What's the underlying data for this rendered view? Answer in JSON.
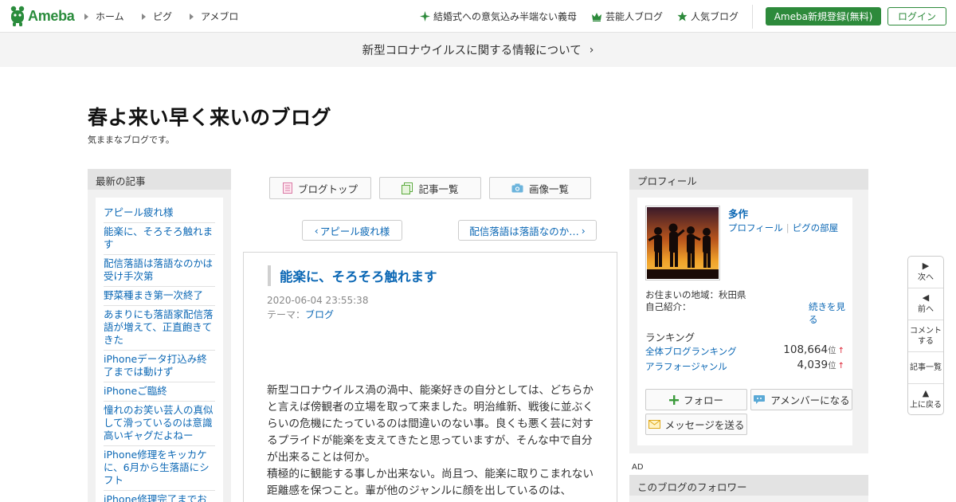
{
  "header": {
    "logo_text": "Ameba",
    "nav": [
      "ホーム",
      "ピグ",
      "アメブロ"
    ],
    "links": [
      {
        "label": "結婚式への意気込み半端ない義母",
        "icon": "sparkle-icon"
      },
      {
        "label": "芸能人ブログ",
        "icon": "crown-icon"
      },
      {
        "label": "人気ブログ",
        "icon": "star-icon"
      }
    ],
    "register_label": "Ameba新規登録(無料)",
    "login_label": "ログイン",
    "accent_color": "#2d8a3b"
  },
  "notice": {
    "text": "新型コロナウイルスに関する情報について",
    "chevron": "›"
  },
  "blog": {
    "title": "春よ来い早く来いのブログ",
    "description": "気ままなブログです。"
  },
  "left": {
    "heading": "最新の記事",
    "items": [
      "アピール疲れ様",
      "能楽に、そろそろ触れます",
      "配信落語は落語なのかは受け手次第",
      "野菜種まき第一次終了",
      "あまりにも落語家配信落語が増えて、正直飽きてきた",
      "iPhoneデータ打込み終了までは動けず",
      "iPhoneご臨終",
      "憧れのお笑い芸人の真似して滑っているのは意識高いギャグだよねー",
      "iPhone修理をキッカケに、6月から生落語にシフト",
      "iPhone修理完了までお休み"
    ]
  },
  "center": {
    "tabs": [
      {
        "label": "ブログトップ",
        "icon": "blog-top-icon"
      },
      {
        "label": "記事一覧",
        "icon": "article-list-icon"
      },
      {
        "label": "画像一覧",
        "icon": "camera-icon"
      }
    ],
    "prev_label": "アピール疲れ様",
    "next_label": "配信落語は落語なのか…",
    "entry": {
      "title": "能楽に、そろそろ触れます",
      "date": "2020-06-04 23:55:38",
      "theme_prefix": "テーマ：",
      "theme": "ブログ",
      "paragraphs": [
        "新型コロナウイルス渦の渦中、能楽好きの自分としては、どちらかと言えば傍観者の立場を取って来ました。明治維新、戦後に並ぶくらいの危機にたっているのは間違いのない事。良くも悪く芸に対するプライドが能楽を支えてきたと思っていますが、そんな中で自分が出来ることは何か。",
        "積極的に観能する事しか出来ない。尚且つ、能楽に取りこまれない距離感を保つこと。輩が他のジャンルに顔を出しているのは、"
      ]
    }
  },
  "profile": {
    "heading": "プロフィール",
    "name": "多作",
    "link_profile": "プロフィール",
    "link_pig": "ピグの部屋",
    "area": "お住まいの地域：秋田県",
    "intro": "自己紹介：",
    "more": "続きを見る",
    "ranking_heading": "ランキング",
    "rankings": [
      {
        "label": "全体ブログランキング",
        "value": "108,664",
        "unit": "位",
        "trend": "↑"
      },
      {
        "label": "アラフォージャンル",
        "value": "4,039",
        "unit": "位",
        "trend": "↑"
      }
    ],
    "follow_label": "フォロー",
    "amember_label": "アメンバーになる",
    "message_label": "メッセージを送る"
  },
  "ad_label": "AD",
  "followers_heading": "このブログのフォロワー",
  "sidenav": [
    {
      "arrow": "▶",
      "label": "次へ"
    },
    {
      "arrow": "◀",
      "label": "前へ"
    },
    {
      "arrow": "",
      "label": "コメント\nする"
    },
    {
      "arrow": "",
      "label": "記事一覧"
    },
    {
      "arrow": "▲",
      "label": "上に戻る"
    }
  ]
}
